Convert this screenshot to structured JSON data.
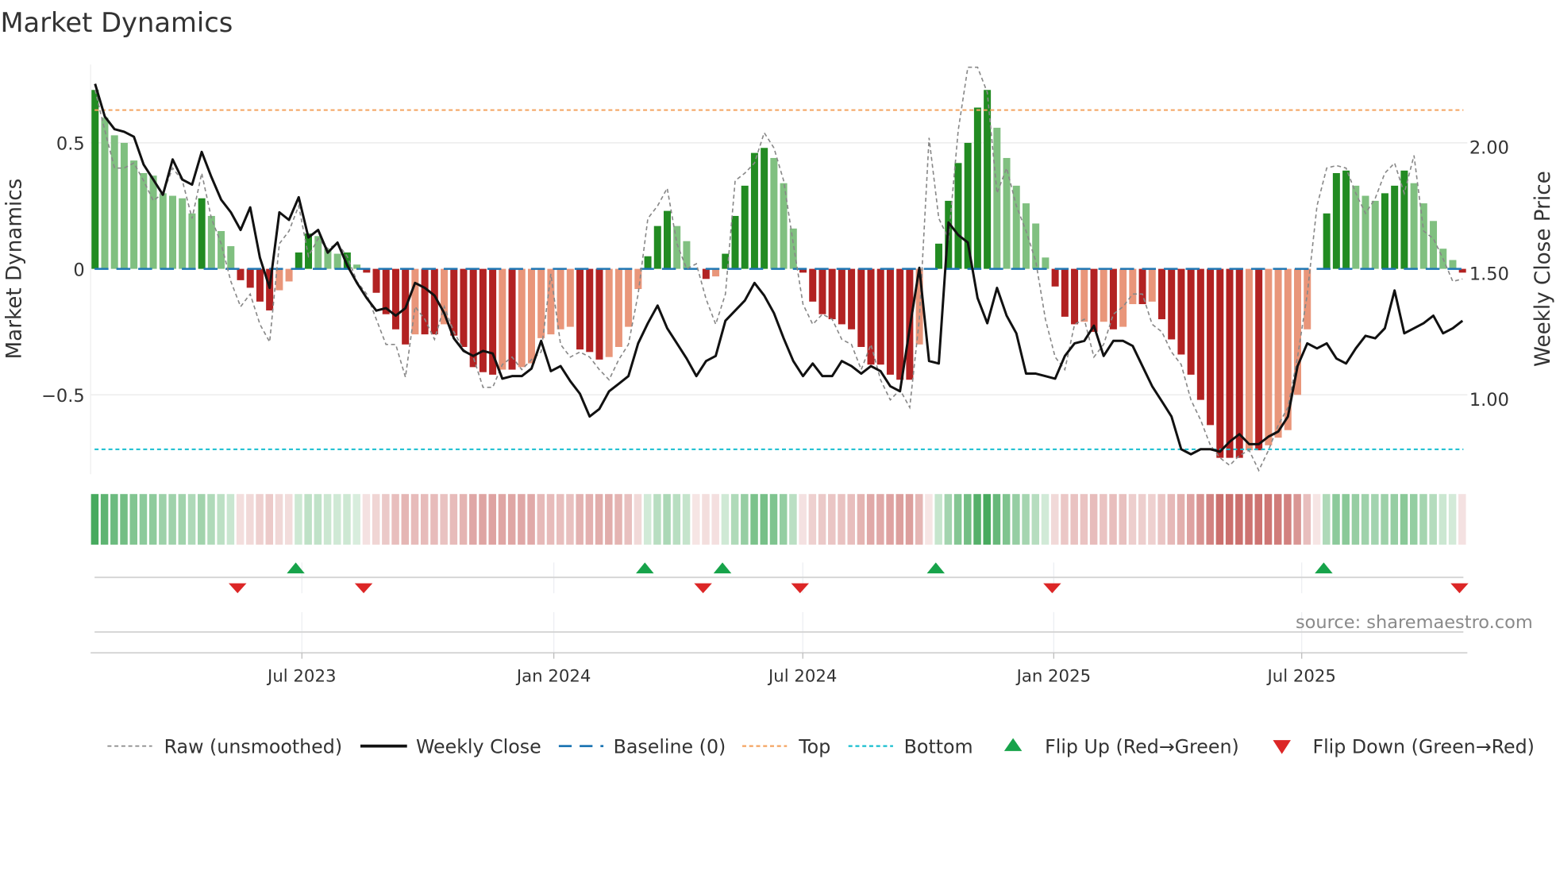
{
  "chart_data": {
    "type": "bar",
    "title": "Market Dynamics",
    "ylabel": "Market Dynamics",
    "y2label": "Weekly Close Price",
    "ylim": [
      -0.82,
      0.82
    ],
    "y2lim": [
      0.73,
      2.38
    ],
    "y_ticks": [
      {
        "value": 0.5,
        "label": "0.5"
      },
      {
        "value": 0,
        "label": "0"
      },
      {
        "value": -0.5,
        "label": "−0.5"
      }
    ],
    "y2_ticks": [
      {
        "value": 2.0,
        "label": "2.00"
      },
      {
        "value": 1.5,
        "label": "1.50"
      },
      {
        "value": 1.0,
        "label": "1.00"
      }
    ],
    "x_ticks": [
      "Jul 2023",
      "Jan 2024",
      "Jul 2024",
      "Jan 2025",
      "Jul 2025"
    ],
    "top_level": 0.63,
    "bottom_level": -0.716,
    "baseline": 0,
    "momentum": [
      0.71,
      0.6,
      0.53,
      0.5,
      0.43,
      0.38,
      0.37,
      0.3,
      0.29,
      0.28,
      0.22,
      0.28,
      0.21,
      0.15,
      0.09,
      -0.045,
      -0.075,
      -0.13,
      -0.165,
      -0.085,
      -0.05,
      0.065,
      0.14,
      0.13,
      0.08,
      0.06,
      0.065,
      0.017,
      -0.015,
      -0.095,
      -0.18,
      -0.24,
      -0.3,
      -0.26,
      -0.26,
      -0.26,
      -0.22,
      -0.265,
      -0.31,
      -0.39,
      -0.41,
      -0.42,
      -0.4,
      -0.4,
      -0.39,
      -0.375,
      -0.275,
      -0.26,
      -0.24,
      -0.23,
      -0.32,
      -0.33,
      -0.36,
      -0.35,
      -0.31,
      -0.23,
      -0.08,
      0.05,
      0.17,
      0.23,
      0.17,
      0.11,
      0,
      -0.04,
      -0.03,
      0.06,
      0.21,
      0.33,
      0.46,
      0.48,
      0.44,
      0.34,
      0.16,
      -0.015,
      -0.13,
      -0.18,
      -0.2,
      -0.22,
      -0.24,
      -0.31,
      -0.38,
      -0.38,
      -0.42,
      -0.44,
      -0.44,
      -0.3,
      0,
      0.1,
      0.27,
      0.42,
      0.5,
      0.64,
      0.71,
      0.56,
      0.44,
      0.33,
      0.26,
      0.18,
      0.045,
      -0.07,
      -0.19,
      -0.22,
      -0.21,
      -0.25,
      -0.21,
      -0.24,
      -0.23,
      -0.14,
      -0.14,
      -0.13,
      -0.2,
      -0.28,
      -0.34,
      -0.42,
      -0.52,
      -0.62,
      -0.75,
      -0.75,
      -0.75,
      -0.72,
      -0.72,
      -0.7,
      -0.67,
      -0.64,
      -0.5,
      -0.24,
      0,
      0.22,
      0.38,
      0.39,
      0.33,
      0.29,
      0.27,
      0.3,
      0.33,
      0.39,
      0.34,
      0.26,
      0.19,
      0.08,
      0.035,
      -0.015
    ],
    "raw": [
      0.71,
      0.55,
      0.4,
      0.4,
      0.42,
      0.35,
      0.27,
      0.3,
      0.4,
      0.35,
      0.2,
      0.38,
      0.2,
      0.1,
      -0.05,
      -0.15,
      -0.1,
      -0.22,
      -0.29,
      0.1,
      0.15,
      0.25,
      0.05,
      0.12,
      0.08,
      0.1,
      0.05,
      -0.05,
      -0.1,
      -0.2,
      -0.3,
      -0.3,
      -0.43,
      -0.15,
      -0.2,
      -0.28,
      -0.15,
      -0.25,
      -0.32,
      -0.35,
      -0.47,
      -0.47,
      -0.38,
      -0.35,
      -0.4,
      -0.36,
      -0.33,
      -0.02,
      -0.3,
      -0.35,
      -0.33,
      -0.35,
      -0.4,
      -0.44,
      -0.36,
      -0.3,
      -0.1,
      0.2,
      0.25,
      0.32,
      0.1,
      0.0,
      0.02,
      -0.12,
      -0.22,
      -0.1,
      0.35,
      0.38,
      0.42,
      0.54,
      0.48,
      0.35,
      0.1,
      -0.14,
      -0.22,
      -0.18,
      -0.2,
      -0.28,
      -0.3,
      -0.4,
      -0.3,
      -0.44,
      -0.52,
      -0.48,
      -0.55,
      -0.2,
      0.52,
      0.2,
      0.12,
      0.55,
      0.8,
      0.8,
      0.7,
      0.3,
      0.4,
      0.25,
      0.15,
      0.03,
      -0.2,
      -0.35,
      -0.4,
      -0.22,
      -0.2,
      -0.35,
      -0.3,
      -0.18,
      -0.15,
      -0.1,
      -0.1,
      -0.22,
      -0.25,
      -0.33,
      -0.38,
      -0.52,
      -0.6,
      -0.7,
      -0.75,
      -0.78,
      -0.74,
      -0.72,
      -0.8,
      -0.72,
      -0.62,
      -0.55,
      -0.35,
      -0.1,
      0.25,
      0.4,
      0.41,
      0.4,
      0.3,
      0.22,
      0.28,
      0.38,
      0.42,
      0.3,
      0.45,
      0.15,
      0.12,
      0.04,
      -0.05,
      -0.04
    ],
    "weekly_close": [
      2.25,
      2.12,
      2.07,
      2.06,
      2.04,
      1.93,
      1.87,
      1.81,
      1.95,
      1.87,
      1.85,
      1.98,
      1.88,
      1.79,
      1.74,
      1.67,
      1.76,
      1.56,
      1.44,
      1.74,
      1.71,
      1.8,
      1.64,
      1.67,
      1.58,
      1.62,
      1.53,
      1.46,
      1.4,
      1.35,
      1.36,
      1.33,
      1.36,
      1.46,
      1.44,
      1.41,
      1.34,
      1.24,
      1.19,
      1.17,
      1.19,
      1.18,
      1.08,
      1.09,
      1.09,
      1.12,
      1.23,
      1.11,
      1.13,
      1.07,
      1.02,
      0.93,
      0.96,
      1.03,
      1.06,
      1.09,
      1.22,
      1.3,
      1.37,
      1.28,
      1.22,
      1.16,
      1.09,
      1.15,
      1.17,
      1.31,
      1.35,
      1.39,
      1.46,
      1.41,
      1.34,
      1.24,
      1.15,
      1.09,
      1.14,
      1.09,
      1.09,
      1.15,
      1.13,
      1.1,
      1.13,
      1.11,
      1.05,
      1.03,
      1.28,
      1.52,
      1.15,
      1.14,
      1.7,
      1.65,
      1.62,
      1.4,
      1.3,
      1.44,
      1.33,
      1.26,
      1.1,
      1.1,
      1.09,
      1.08,
      1.17,
      1.22,
      1.23,
      1.29,
      1.17,
      1.23,
      1.23,
      1.21,
      1.13,
      1.05,
      0.99,
      0.93,
      0.8,
      0.78,
      0.8,
      0.8,
      0.79,
      0.83,
      0.86,
      0.82,
      0.82,
      0.85,
      0.87,
      0.93,
      1.13,
      1.22,
      1.2,
      1.22,
      1.16,
      1.14,
      1.2,
      1.25,
      1.24,
      1.28,
      1.43,
      1.26,
      1.28,
      1.3,
      1.33,
      1.26,
      1.28,
      1.31
    ],
    "flip_up_weeks": [
      21,
      57,
      65,
      87,
      127
    ],
    "flip_down_weeks": [
      15,
      28,
      63,
      73,
      99,
      141
    ],
    "legend": [
      {
        "label": "Raw (unsmoothed)",
        "kind": "raw"
      },
      {
        "label": "Weekly Close",
        "kind": "close"
      },
      {
        "label": "Baseline (0)",
        "kind": "baseline"
      },
      {
        "label": "Top",
        "kind": "top"
      },
      {
        "label": "Bottom",
        "kind": "bottom"
      },
      {
        "label": "Flip Up (Red→Green)",
        "kind": "up"
      },
      {
        "label": "Flip Down (Green→Red)",
        "kind": "down"
      }
    ],
    "legend_position": "bottom",
    "source": "source: sharemaestro.com",
    "colors": {
      "green_strong": "#228b22",
      "green_light": "#80c080",
      "red_strong": "#b22222",
      "red_light": "#e9967a",
      "baseline": "#1f77b4",
      "top": "#f4a460",
      "bottom": "#17becf",
      "close": "#111111",
      "raw": "#888888",
      "flip_up": "#17a34a",
      "flip_down": "#dc2626",
      "strip_green": "#2e9e48",
      "strip_red": "#c0504d"
    }
  }
}
